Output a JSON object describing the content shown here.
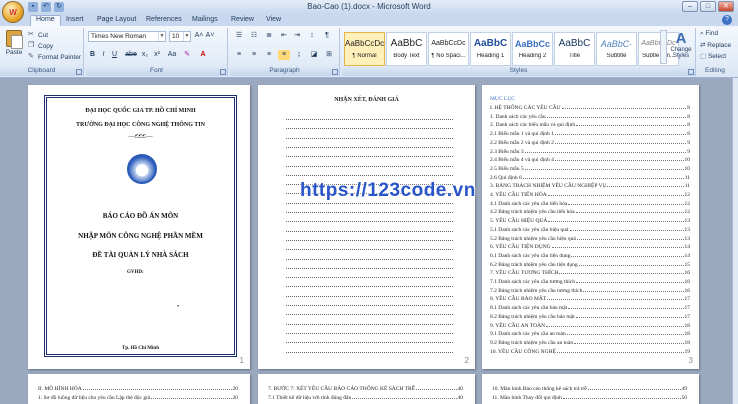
{
  "window": {
    "title": "Bao-Cao (1).docx - Microsoft Word",
    "controls": [
      "–",
      "□",
      "✕"
    ]
  },
  "tabs": [
    "Home",
    "Insert",
    "Page Layout",
    "References",
    "Mailings",
    "Review",
    "View"
  ],
  "ribbon": {
    "clipboard": {
      "label": "Clipboard",
      "paste": "Paste",
      "cut": "Cut",
      "copy": "Copy",
      "format_painter": "Format Painter"
    },
    "font": {
      "label": "Font",
      "name": "Times New Roman",
      "size": "10",
      "bold": "B",
      "italic": "I",
      "underline": "U",
      "strike": "abe",
      "sub": "x₂",
      "sup": "x²",
      "case": "Aa",
      "grow": "A˄",
      "shrink": "A˅"
    },
    "paragraph": {
      "label": "Paragraph"
    },
    "styles": {
      "label": "Styles",
      "items": [
        {
          "sample": "AaBbCcDc",
          "name": "¶ Normal"
        },
        {
          "sample": "AaBbC",
          "name": "Body Text"
        },
        {
          "sample": "AaBbCcDc",
          "name": "¶ No Spaci..."
        },
        {
          "sample": "AaBbC",
          "name": "Heading 1"
        },
        {
          "sample": "AaBbCc",
          "name": "Heading 2"
        },
        {
          "sample": "AaBbC",
          "name": "Title"
        },
        {
          "sample": "AaBbC·",
          "name": "Subtitle"
        },
        {
          "sample": "AaBbCcDc",
          "name": "Subtle Em..."
        }
      ],
      "change_styles": "Change Styles"
    },
    "editing": {
      "label": "Editing",
      "find": "Find",
      "replace": "Replace",
      "select": "Select"
    }
  },
  "pages": {
    "cover": {
      "line1": "ĐẠI HỌC QUỐC GIA TP. HỒ CHÍ MINH",
      "line2": "TRƯỜNG ĐẠI HỌC CÔNG NGHỆ THÔNG TIN",
      "ornament": "----ඞඞඞ----",
      "title1": "BÁO CÁO ĐỒ ÁN MÔN",
      "title2": "NHẬP MÔN CÔNG NGHỆ PHẦN MỀM",
      "title3": "ĐỀ TÀI QUẢN LÝ NHÀ SÁCH",
      "gvhd": "GVHD:",
      "bullet": "•",
      "city": "Tp. Hồ Chí Minh",
      "num": "1"
    },
    "review": {
      "heading": "NHẬN XÉT, ĐÁNH GIÁ",
      "num": "2"
    },
    "toc": {
      "heading": "MỤC LỤC",
      "num": "3",
      "entries": [
        {
          "t": "I.   HỆ THỐNG CÁC YÊU CẦU",
          "p": "8"
        },
        {
          "t": "1.  Danh sách các yêu cầu",
          "p": "8"
        },
        {
          "t": "2.  Danh sách các biểu mẫu và qui định",
          "p": "8"
        },
        {
          "t": "2.1 Biểu mẫu 1 và qui định 1",
          "p": "8"
        },
        {
          "t": "2.2 Biểu mẫu 2 và qui định 2",
          "p": "9"
        },
        {
          "t": "2.3 Biểu mẫu 3",
          "p": "9"
        },
        {
          "t": "2.4 Biểu mẫu 4 và qui định 4",
          "p": "10"
        },
        {
          "t": "2.5 Biểu mẫu 5",
          "p": "10"
        },
        {
          "t": "2.6 Qui định 6",
          "p": "11"
        },
        {
          "t": "3.  BẢNG TRÁCH NHIỆM YÊU CẦU NGHIỆP VỤ",
          "p": "11"
        },
        {
          "t": "4.  YÊU CẦU TIẾN HÓA",
          "p": "12"
        },
        {
          "t": "4.1 Danh sách các yêu cầu tiến hóa",
          "p": "12"
        },
        {
          "t": "4.2 Bảng trách nhiệm yêu cầu tiến hóa",
          "p": "12"
        },
        {
          "t": "5.  YÊU CẦU HIỆU QUẢ",
          "p": "13"
        },
        {
          "t": "5.1 Danh sách các yêu cầu hiệu quả",
          "p": "13"
        },
        {
          "t": "5.2 Bảng trách nhiệm yêu cầu hiệu quả",
          "p": "13"
        },
        {
          "t": "6.  YÊU CẦU TIỆN DỤNG",
          "p": "14"
        },
        {
          "t": "6.1 Danh sách các yêu cầu tiện dụng",
          "p": "14"
        },
        {
          "t": "6.2 Bảng trách nhiệm yêu cầu tiện dụng",
          "p": "15"
        },
        {
          "t": "7.  YÊU CẦU TƯƠNG THÍCH",
          "p": "16"
        },
        {
          "t": "7.1 Danh sách các yêu cầu tương thích",
          "p": "16"
        },
        {
          "t": "7.2 Bảng trách nhiệm yêu cầu tương thích",
          "p": "16"
        },
        {
          "t": "8.  YÊU CẦU BẢO MẬT",
          "p": "17"
        },
        {
          "t": "8.1 Danh sách các yêu cầu bảo mật",
          "p": "17"
        },
        {
          "t": "8.2 Bảng trách nhiệm yêu cầu bảo mật",
          "p": "17"
        },
        {
          "t": "9.  YÊU CẦU AN TOÀN",
          "p": "18"
        },
        {
          "t": "9.1 Danh sách các yêu cầu an toàn",
          "p": "18"
        },
        {
          "t": "9.2 Bảng trách nhiệm yêu cầu an toàn",
          "p": "18"
        },
        {
          "t": "10.  YÊU CẦU CÔNG NGHỆ",
          "p": "19"
        }
      ]
    },
    "bottom": {
      "p4": [
        {
          "t": "II.    MÔ HÌNH HÓA",
          "p": "20"
        },
        {
          "t": "1.  Sơ đồ luồng dữ liệu cho yêu cầu Lập thẻ độc giả",
          "p": "20"
        }
      ],
      "p5": [
        {
          "t": "7.  BƯỚC 7: XÉT YÊU CẦU BÁO CÁO THỐNG KÊ SÁCH TRỄ",
          "p": "40"
        },
        {
          "t": "7.1 Thiết kế dữ liệu với tính đúng đắn",
          "p": "40"
        }
      ],
      "p6": [
        {
          "t": "10.  Màn hình Báo cáo thống kê sách trả trễ",
          "p": "49"
        },
        {
          "t": "11.  Màn hình Thay đổi qui định",
          "p": "50"
        }
      ]
    }
  },
  "watermark": "https://123code.vn"
}
